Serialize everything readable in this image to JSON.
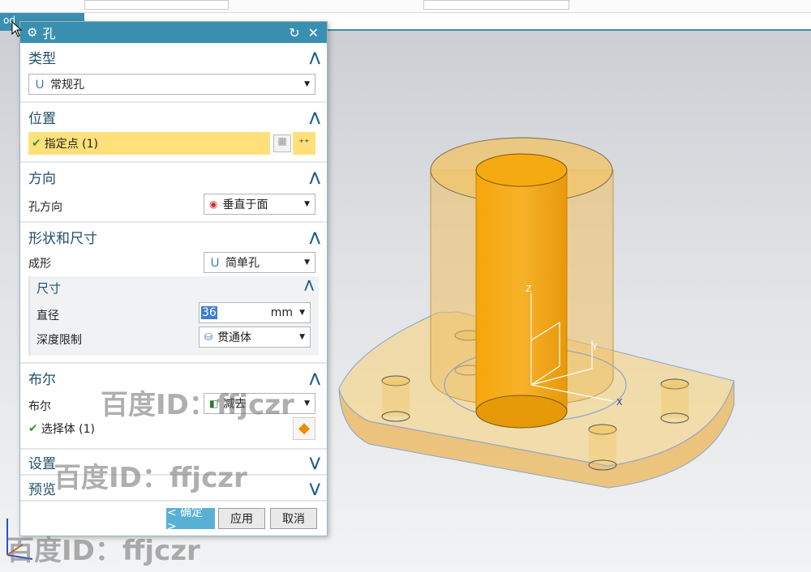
{
  "tab": {
    "label": "od"
  },
  "dialog": {
    "title": "孔",
    "sections": {
      "type": {
        "title": "类型",
        "value": "常规孔"
      },
      "position": {
        "title": "位置",
        "point_label": "指定点 (1)"
      },
      "direction": {
        "title": "方向",
        "label": "孔方向",
        "value": "垂直于面"
      },
      "shape": {
        "title": "形状和尺寸",
        "form_label": "成形",
        "form_value": "简单孔",
        "dim_title": "尺寸",
        "diameter_label": "直径",
        "diameter_value": "36",
        "diameter_unit": "mm",
        "depth_label": "深度限制",
        "depth_value": "贯通体"
      },
      "boolean": {
        "title": "布尔",
        "label": "布尔",
        "value": "减去",
        "select_label": "选择体 (1)"
      },
      "settings": {
        "title": "设置"
      },
      "preview": {
        "title": "预览"
      }
    },
    "buttons": {
      "ok": "< 确定 >",
      "apply": "应用",
      "cancel": "取消"
    }
  },
  "viewport": {
    "axis_labels": {
      "z": "Z",
      "y": "Y",
      "x": "X"
    },
    "colors": {
      "solid": "#f1c25a",
      "hole": "#f2a20c",
      "edge": "#8aa4cf"
    }
  },
  "watermark": "百度ID：ffjczr"
}
